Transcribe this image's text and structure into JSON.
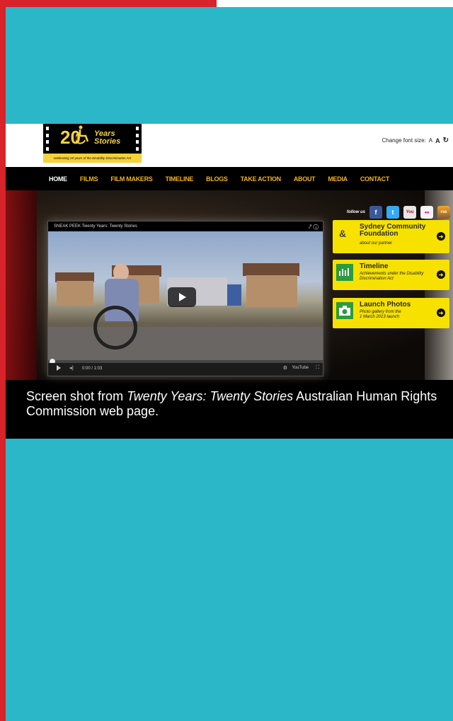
{
  "site": {
    "logo": {
      "number": "20",
      "word1": "Years",
      "word2": "Stories",
      "tagline": "celebrating 20 years of the Disability Discrimination Act"
    },
    "font_size": {
      "label": "Change font size:",
      "small": "A",
      "large": "A",
      "reset_icon": "refresh-icon"
    },
    "nav": [
      "HOME",
      "FILMS",
      "FILM MAKERS",
      "TIMELINE",
      "BLOGS",
      "TAKE ACTION",
      "ABOUT",
      "MEDIA",
      "CONTACT"
    ],
    "video": {
      "title": "SNEAK PEEK Twenty Years: Twenty Stories",
      "time": "0:00 / 1:03",
      "brand": "YouTube"
    },
    "follow": {
      "label": "follow us",
      "icons": [
        "f",
        "t",
        "You",
        "••",
        "rss"
      ]
    },
    "promos": [
      {
        "title_line1": "Sydney Community",
        "title_line2": "Foundation",
        "sub_line1": "about our partner",
        "sub_line2": ""
      },
      {
        "title_line1": "Timeline",
        "title_line2": "",
        "sub_line1": "Achievements under the Disability",
        "sub_line2": "Discrimination Act"
      },
      {
        "title_line1": "Launch Photos",
        "title_line2": "",
        "sub_line1": "Photo gallery from the",
        "sub_line2": "1 March 2013 launch"
      }
    ]
  },
  "caption": {
    "before": "Screen shot from ",
    "italic": "Twenty Years: Twenty Stories",
    "after": " Australian Human Rights Commission web page."
  },
  "colors": {
    "background": "#2cb7c8",
    "accent_red": "#d8232a",
    "nav_orange": "#f2b21c",
    "promo_yellow": "#f6e100"
  }
}
